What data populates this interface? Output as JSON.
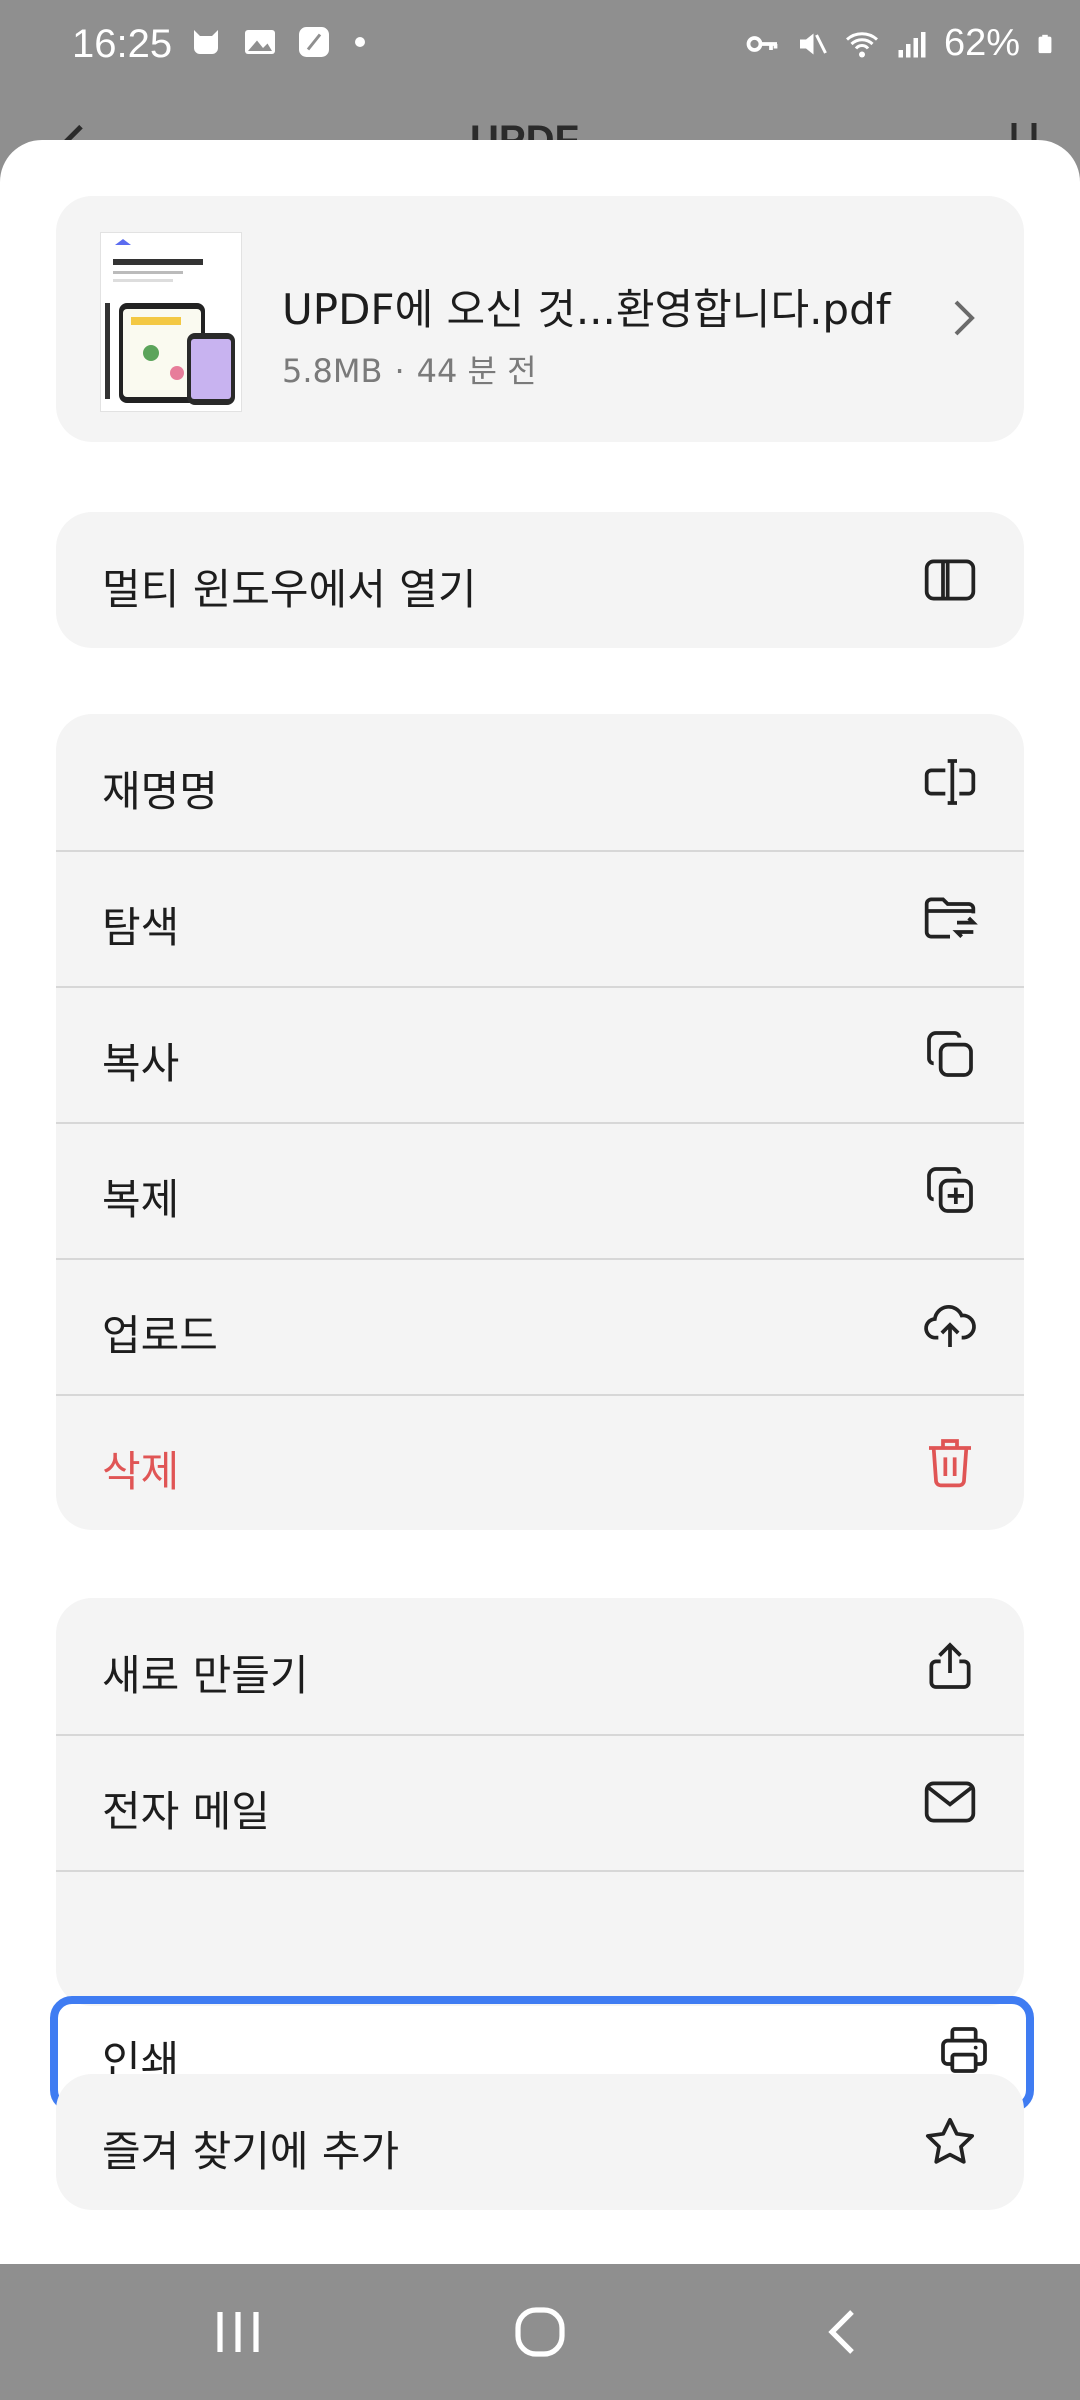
{
  "status_bar": {
    "time": "16:25",
    "battery": "62%"
  },
  "background_app": {
    "title": "UPDF"
  },
  "file": {
    "name": "UPDF에 오신 것...환영합니다.pdf",
    "size": "5.8MB",
    "separator": "·",
    "modified": "44 분 전"
  },
  "groups": {
    "multi_window": {
      "label": "멀티 윈도우에서 열기"
    },
    "file_actions": [
      {
        "label": "재명명",
        "icon": "rename-icon"
      },
      {
        "label": "탐색",
        "icon": "folder-explore-icon"
      },
      {
        "label": "복사",
        "icon": "copy-icon"
      },
      {
        "label": "복제",
        "icon": "duplicate-icon"
      },
      {
        "label": "업로드",
        "icon": "cloud-upload-icon"
      },
      {
        "label": "삭제",
        "icon": "trash-icon"
      }
    ],
    "share_actions": [
      {
        "label": "새로 만들기",
        "icon": "share-icon"
      },
      {
        "label": "전자 메일",
        "icon": "mail-icon"
      },
      {
        "label": "인쇄",
        "icon": "printer-icon"
      }
    ],
    "favorites": {
      "label": "즐겨 찾기에 추가"
    }
  },
  "colors": {
    "danger": "#e05555",
    "highlight": "#3f7cf2",
    "card_bg": "#f4f4f4"
  }
}
